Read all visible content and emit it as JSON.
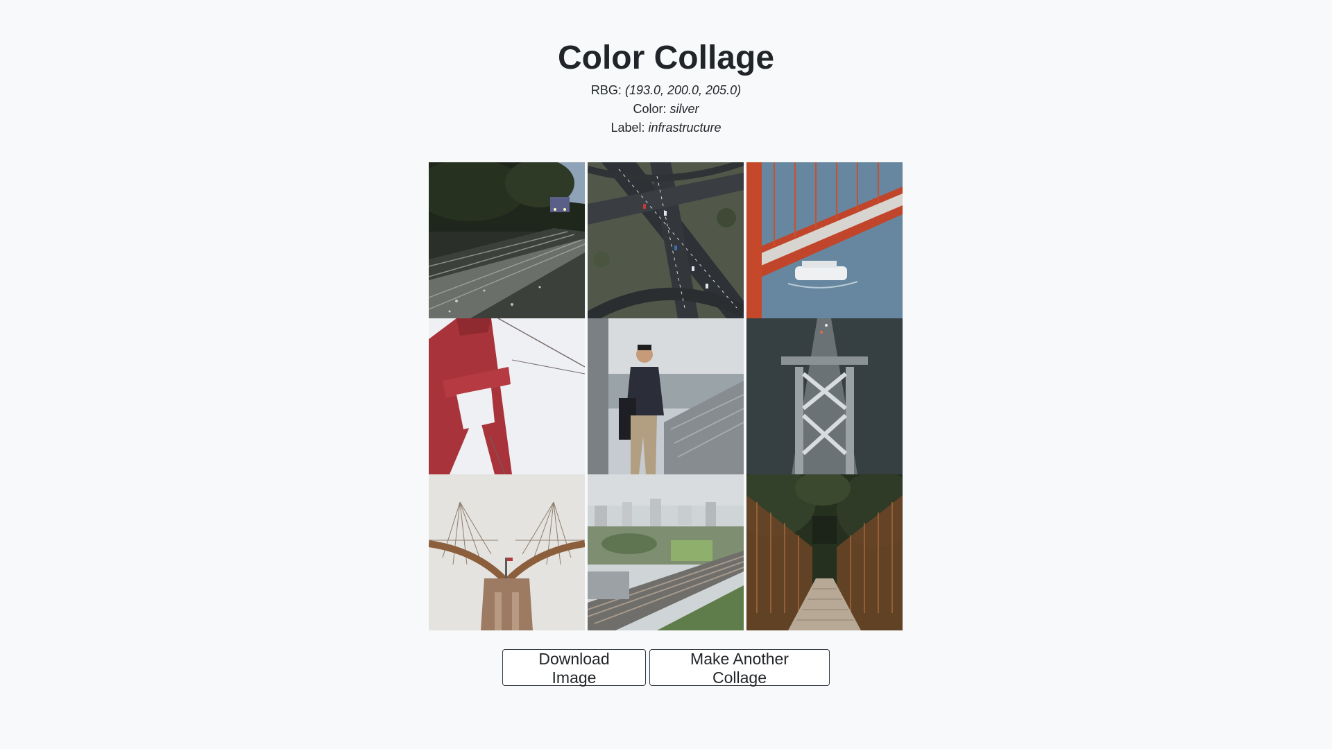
{
  "header": {
    "title": "Color Collage",
    "rgb_label": "RBG:",
    "rgb_value": "(193.0, 200.0, 205.0)",
    "color_label": "Color:",
    "color_value": "silver",
    "label_label": "Label:",
    "label_value": "infrastructure"
  },
  "collage": {
    "tiles": [
      {
        "icon": "railway-track-forest-photo"
      },
      {
        "icon": "highway-interchange-aerial-photo"
      },
      {
        "icon": "red-bridge-ferry-aerial-photo"
      },
      {
        "icon": "red-bridge-tower-upward-photo"
      },
      {
        "icon": "man-on-balcony-city-photo"
      },
      {
        "icon": "bridge-tower-over-water-aerial-photo"
      },
      {
        "icon": "suspension-bridge-cables-photo"
      },
      {
        "icon": "city-rail-lines-aerial-photo"
      },
      {
        "icon": "rope-bridge-forest-photo"
      }
    ]
  },
  "actions": {
    "download_label": "Download Image",
    "another_label": "Make Another Collage"
  }
}
